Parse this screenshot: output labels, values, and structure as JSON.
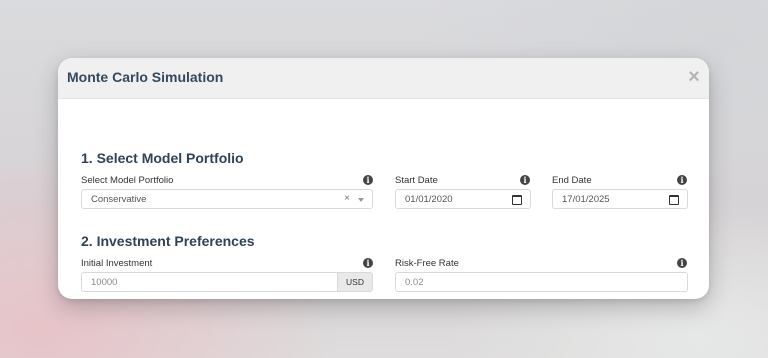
{
  "modal": {
    "title": "Monte Carlo Simulation",
    "close_symbol": "×"
  },
  "section1": {
    "title": "1. Select Model Portfolio",
    "model_portfolio": {
      "label": "Select Model Portfolio",
      "value": "Conservative",
      "clear_symbol": "×"
    },
    "start_date": {
      "label": "Start Date",
      "value": "01/01/2020"
    },
    "end_date": {
      "label": "End Date",
      "value": "17/01/2025"
    }
  },
  "section2": {
    "title": "2. Investment Preferences",
    "initial_investment": {
      "label": "Initial Investment",
      "value": "10000",
      "addon": "USD"
    },
    "risk_free_rate": {
      "label": "Risk-Free Rate",
      "value": "0.02"
    }
  },
  "icons": {
    "info": "i"
  }
}
